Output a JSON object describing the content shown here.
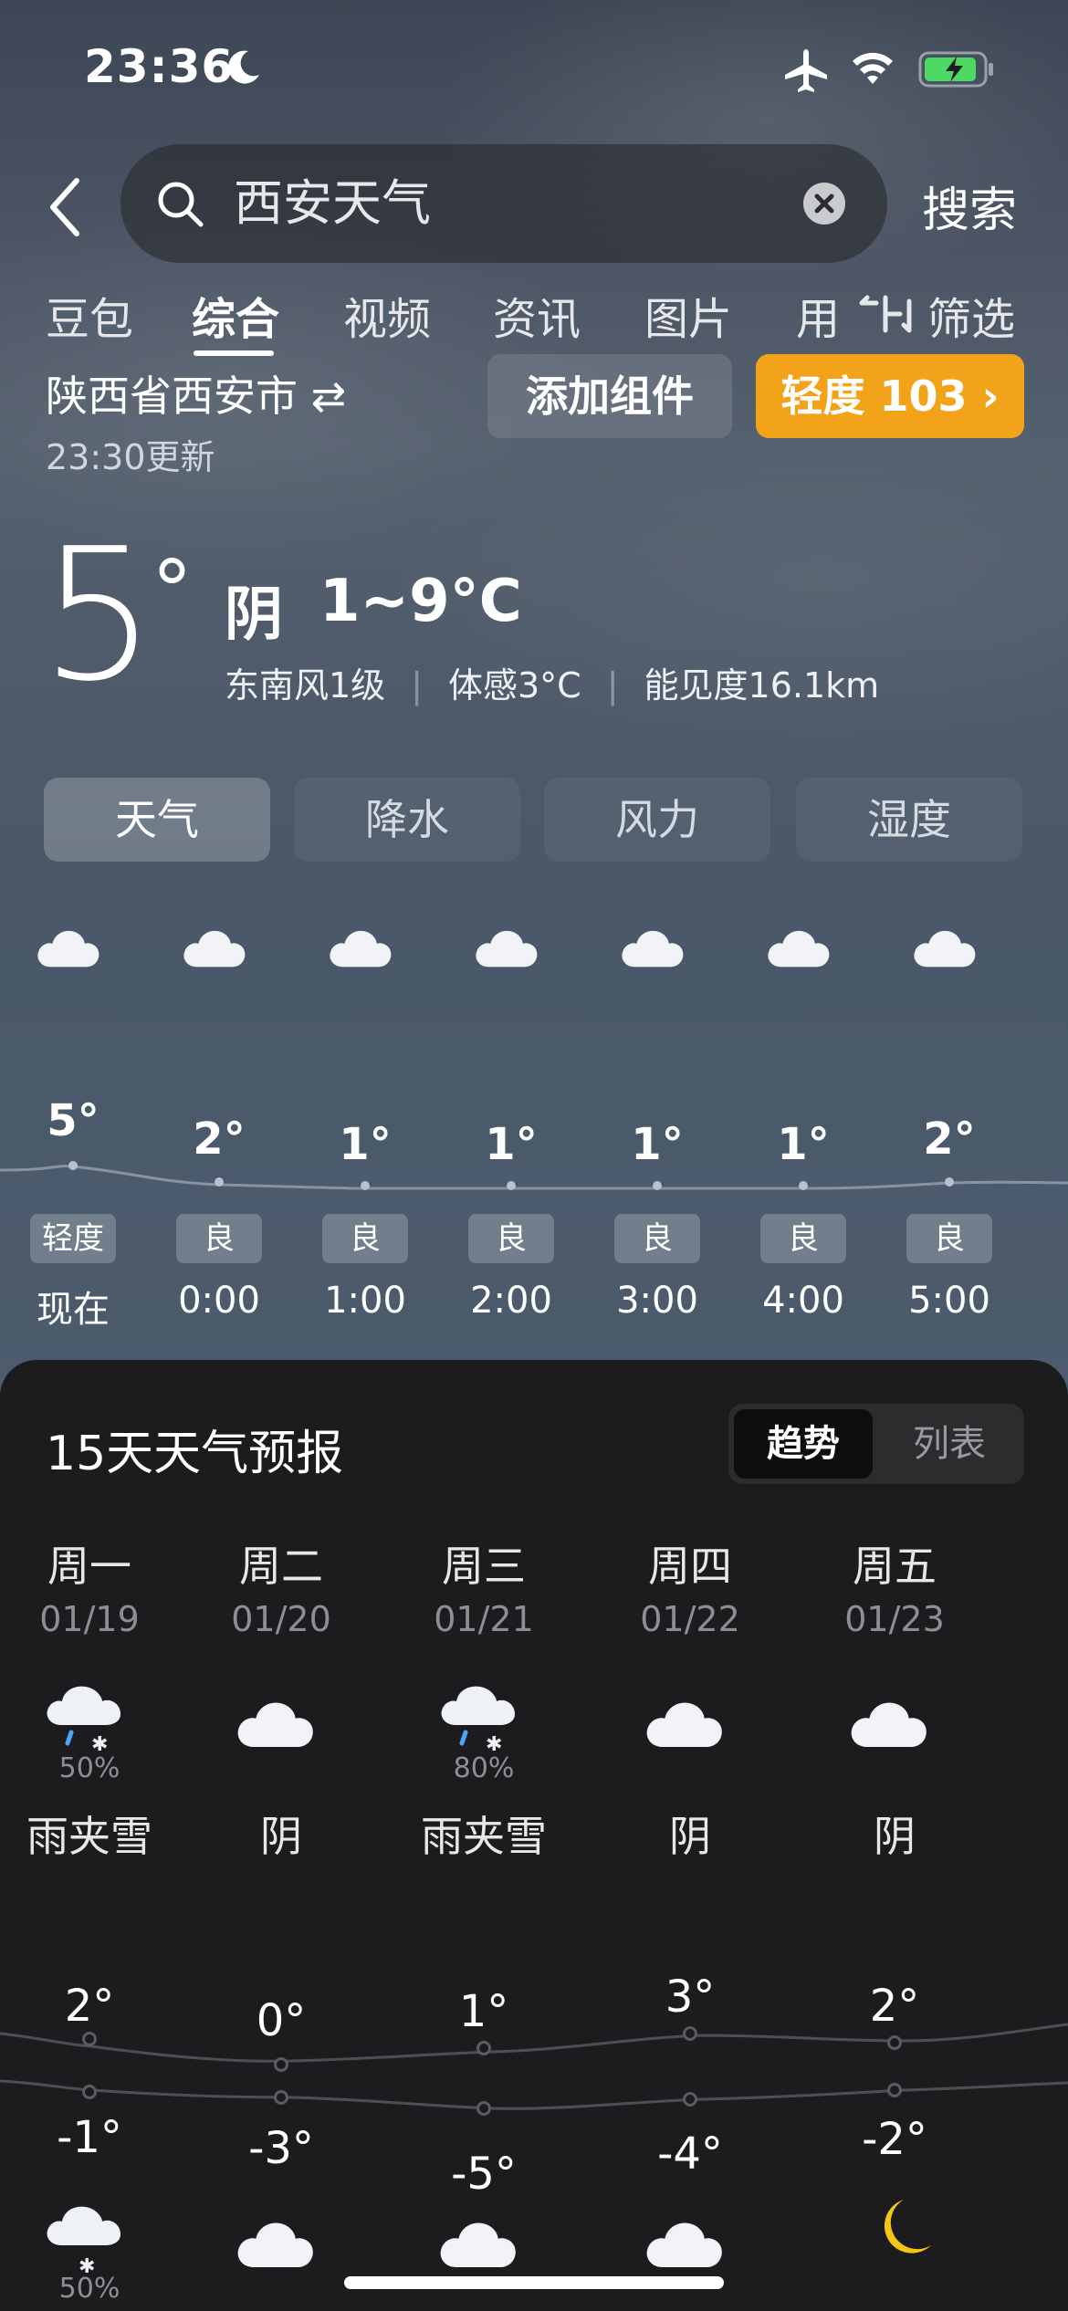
{
  "status_bar": {
    "time": "23:36"
  },
  "search": {
    "query": "西安天气",
    "button": "搜索"
  },
  "categories": [
    "豆包",
    "综合",
    "视频",
    "资讯",
    "图片",
    "用"
  ],
  "filter_label": "筛选",
  "location": {
    "name": "陕西省西安市 ⇄",
    "updated": "23:30更新"
  },
  "actions": {
    "add_widget": "添加组件",
    "aqi": "轻度 103 ›"
  },
  "current": {
    "temp": "5",
    "deg": "°",
    "condition": "阴",
    "range": "1~9°C",
    "wind": "东南风1级",
    "feels_like": "体感3°C",
    "visibility": "能见度16.1km"
  },
  "segments": [
    "天气",
    "降水",
    "风力",
    "湿度"
  ],
  "hourly": [
    {
      "time": "现在",
      "temp": "5°",
      "aqi": "轻度",
      "icon": "cloud-icon"
    },
    {
      "time": "0:00",
      "temp": "2°",
      "aqi": "良",
      "icon": "cloudy-night-icon"
    },
    {
      "time": "1:00",
      "temp": "1°",
      "aqi": "良",
      "icon": "cloudy-night-icon"
    },
    {
      "time": "2:00",
      "temp": "1°",
      "aqi": "良",
      "icon": "cloudy-night-icon"
    },
    {
      "time": "3:00",
      "temp": "1°",
      "aqi": "良",
      "icon": "cloudy-night-icon"
    },
    {
      "time": "4:00",
      "temp": "1°",
      "aqi": "良",
      "icon": "cloudy-night-icon"
    },
    {
      "time": "5:00",
      "temp": "2°",
      "aqi": "良",
      "icon": "cloudy-night-icon"
    }
  ],
  "forecast": {
    "title": "15天天气预报",
    "toggle": [
      "趋势",
      "列表"
    ],
    "days": [
      {
        "name": "周一",
        "date": "01/19",
        "icon": "sleet-icon",
        "prob": "50%",
        "condition": "雨夹雪",
        "high": "2°",
        "low": "-1°",
        "night_icon": "snow-cloud-icon",
        "night_prob": "50%"
      },
      {
        "name": "周二",
        "date": "01/20",
        "icon": "cloud-icon",
        "prob": "",
        "condition": "阴",
        "high": "0°",
        "low": "-3°",
        "night_icon": "cloud-icon",
        "night_prob": ""
      },
      {
        "name": "周三",
        "date": "01/21",
        "icon": "sleet-icon",
        "prob": "80%",
        "condition": "雨夹雪",
        "high": "1°",
        "low": "-5°",
        "night_icon": "cloud-icon",
        "night_prob": ""
      },
      {
        "name": "周四",
        "date": "01/22",
        "icon": "cloud-icon",
        "prob": "",
        "condition": "阴",
        "high": "3°",
        "low": "-4°",
        "night_icon": "cloud-icon",
        "night_prob": ""
      },
      {
        "name": "周五",
        "date": "01/23",
        "icon": "cloud-icon",
        "prob": "",
        "condition": "阴",
        "high": "2°",
        "low": "-2°",
        "night_icon": "moon-icon",
        "night_prob": ""
      }
    ]
  },
  "colors": {
    "aqi_orange": "#f2a31a",
    "panel_bg": "#1c1c1e",
    "sky": "#4c5868"
  }
}
